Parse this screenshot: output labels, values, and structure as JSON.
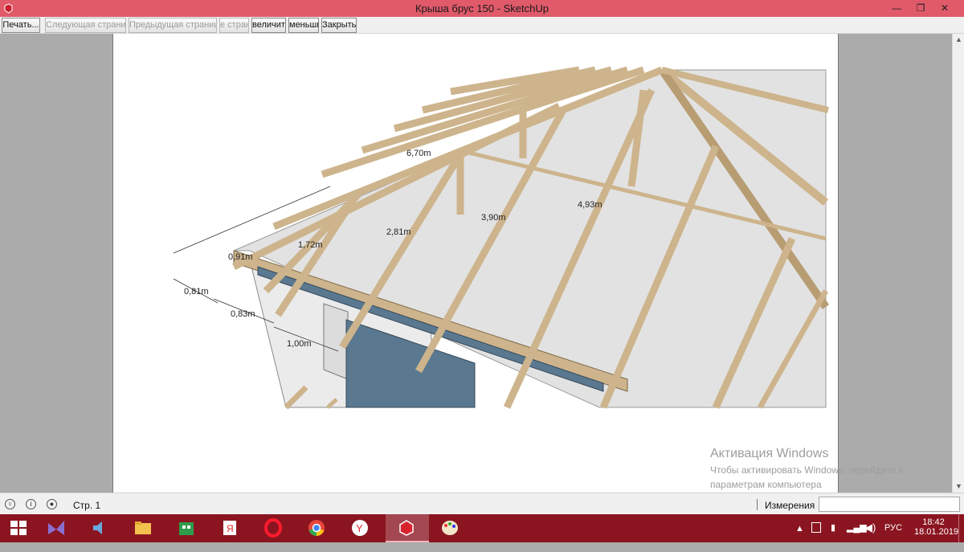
{
  "window": {
    "title": "Крыша брус 150 - SketchUp",
    "controls": {
      "minimize": "—",
      "restore": "❐",
      "close": "✕"
    }
  },
  "toolbar": {
    "buttons": [
      {
        "label": "Печать...",
        "enabled": true
      },
      {
        "label": "Следующая страница",
        "enabled": false
      },
      {
        "label": "Предыдущая страница",
        "enabled": false
      },
      {
        "label": "е стран",
        "enabled": false
      },
      {
        "label": "величить",
        "enabled": true
      },
      {
        "label": "меньши",
        "enabled": true
      },
      {
        "label": "Закрыть",
        "enabled": true
      }
    ]
  },
  "drawing": {
    "dimensions": [
      "6,70m",
      "4,93m",
      "3,90m",
      "2,81m",
      "1,72m",
      "0,91m",
      "0,81m",
      "0,83m",
      "1,00m"
    ]
  },
  "watermark": {
    "title": "Активация Windows",
    "line1": "Чтобы активировать Windows, перейдите к",
    "line2": "параметрам компьютера"
  },
  "statusbar": {
    "page": "Стр. 1",
    "measurements_label": "Измерения",
    "measurements_value": ""
  },
  "taskbar": {
    "apps": [
      "start",
      "visual-studio",
      "media-player",
      "file-explorer",
      "store",
      "yandex-browser",
      "opera",
      "chrome",
      "yandex",
      "sketchup",
      "paint"
    ],
    "active_app": "sketchup",
    "tray": {
      "language": "РУС",
      "time": "18:42",
      "date": "18.01.2019"
    }
  },
  "colors": {
    "titlebar": "#e05a6a",
    "taskbar": "#8a1520",
    "timber": "#cdb48c",
    "window_glass": "#5a7890"
  }
}
